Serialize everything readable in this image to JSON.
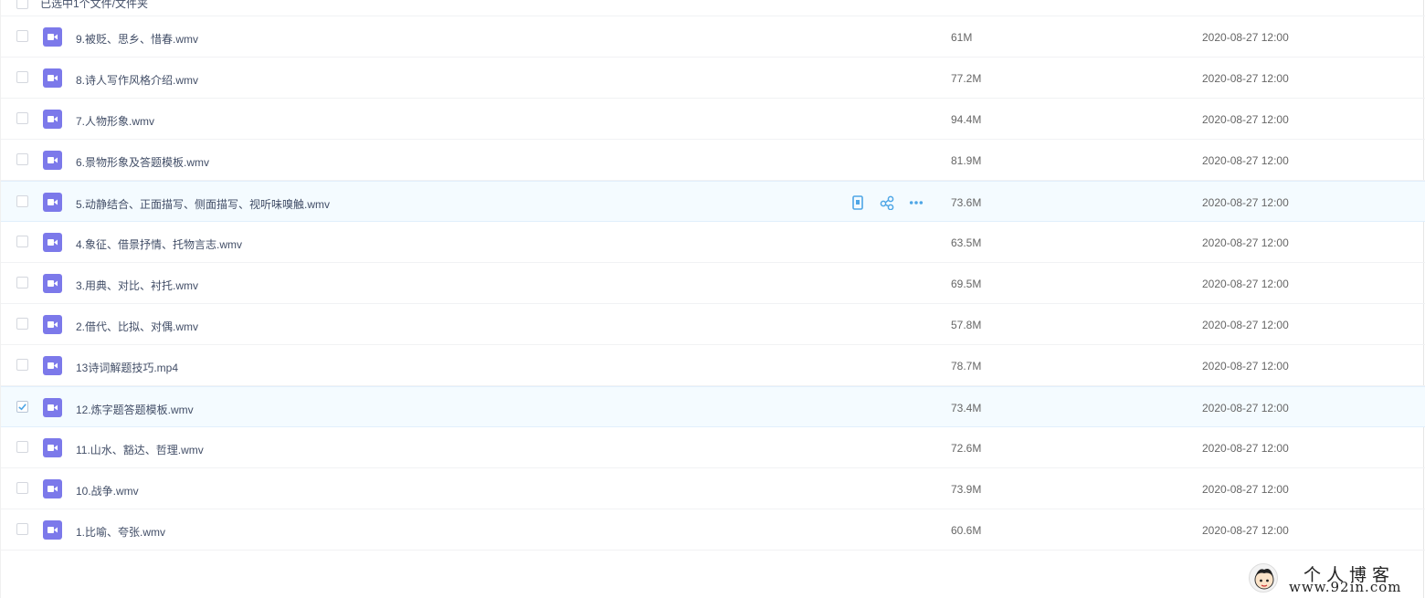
{
  "header": {
    "selected_text": "已选中1个文件/文件夹"
  },
  "files": [
    {
      "name": "9.被贬、思乡、惜春.wmv",
      "size": "61M",
      "date": "2020-08-27 12:00",
      "checked": false,
      "hover": false
    },
    {
      "name": "8.诗人写作风格介绍.wmv",
      "size": "77.2M",
      "date": "2020-08-27 12:00",
      "checked": false,
      "hover": false
    },
    {
      "name": "7.人物形象.wmv",
      "size": "94.4M",
      "date": "2020-08-27 12:00",
      "checked": false,
      "hover": false
    },
    {
      "name": "6.景物形象及答题模板.wmv",
      "size": "81.9M",
      "date": "2020-08-27 12:00",
      "checked": false,
      "hover": false
    },
    {
      "name": "5.动静结合、正面描写、侧面描写、视听味嗅触.wmv",
      "size": "73.6M",
      "date": "2020-08-27 12:00",
      "checked": false,
      "hover": true
    },
    {
      "name": "4.象征、借景抒情、托物言志.wmv",
      "size": "63.5M",
      "date": "2020-08-27 12:00",
      "checked": false,
      "hover": false
    },
    {
      "name": "3.用典、对比、衬托.wmv",
      "size": "69.5M",
      "date": "2020-08-27 12:00",
      "checked": false,
      "hover": false
    },
    {
      "name": "2.借代、比拟、对偶.wmv",
      "size": "57.8M",
      "date": "2020-08-27 12:00",
      "checked": false,
      "hover": false
    },
    {
      "name": "13诗词解题技巧.mp4",
      "size": "78.7M",
      "date": "2020-08-27 12:00",
      "checked": false,
      "hover": false
    },
    {
      "name": "12.炼字题答题模板.wmv",
      "size": "73.4M",
      "date": "2020-08-27 12:00",
      "checked": true,
      "hover": false
    },
    {
      "name": "11.山水、豁达、哲理.wmv",
      "size": "72.6M",
      "date": "2020-08-27 12:00",
      "checked": false,
      "hover": false
    },
    {
      "name": "10.战争.wmv",
      "size": "73.9M",
      "date": "2020-08-27 12:00",
      "checked": false,
      "hover": false
    },
    {
      "name": "1.比喻、夸张.wmv",
      "size": "60.6M",
      "date": "2020-08-27 12:00",
      "checked": false,
      "hover": false
    }
  ],
  "row_actions": [
    {
      "icon": "phone-icon"
    },
    {
      "icon": "share-icon"
    },
    {
      "icon": "more-icon"
    }
  ],
  "watermark": {
    "title": "个人博客",
    "url": "www.92in.com"
  },
  "colors": {
    "file_icon": "#7c79ea",
    "accent": "#4ea6e6",
    "row_highlight": "#f4fbff"
  }
}
